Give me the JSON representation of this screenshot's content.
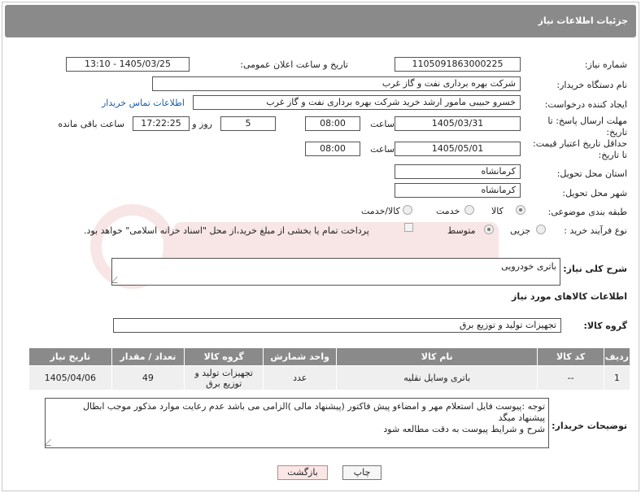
{
  "header": {
    "title": "جزئیات اطلاعات نیاز"
  },
  "form": {
    "need_number_label": "شماره نیاز:",
    "need_number": "1105091863000225",
    "announce_label": "تاریخ و ساعت اعلان عمومی:",
    "announce_value": "1405/03/25 - 13:10",
    "buyer_org_label": "نام دستگاه خریدار:",
    "buyer_org": "شرکت بهره برداری نفت و گاز غرب",
    "creator_label": "ایجاد کننده درخواست:",
    "creator": "خسرو حبیبی مامور ارشد خرید شرکت بهره برداری نفت و گاز غرب",
    "contact_link": "اطلاعات تماس خریدار",
    "deadline_label_1": "مهلت ارسال پاسخ: تا",
    "deadline_label_2": "تاریخ:",
    "deadline_date": "1405/03/31",
    "time_label": "ساعت",
    "deadline_time": "08:00",
    "days_value": "5",
    "days_label": "روز و",
    "remaining_time": "17:22:25",
    "remaining_label": "ساعت باقی مانده",
    "validity_label_1": "حداقل تاریخ اعتبار قیمت:",
    "validity_label_2": "تا تاریخ:",
    "validity_date": "1405/05/01",
    "validity_time": "08:00",
    "province_label": "استان محل تحویل:",
    "province": "کرمانشاه",
    "city_label": "شهر محل تحویل:",
    "city": "کرمانشاه",
    "category_label": "طبقه بندی موضوعی:",
    "category_options": [
      "کالا",
      "خدمت",
      "کالا/خدمت"
    ],
    "category_selected": "کالا",
    "process_label": "نوع فرآیند خرید :",
    "process_options": [
      "جزیی",
      "متوسط"
    ],
    "process_selected": "متوسط",
    "payment_note": "پرداخت تمام یا بخشی از مبلغ خرید،از محل \"اسناد خزانه اسلامی\" خواهد بود."
  },
  "description": {
    "label": "شرح کلی نیاز:",
    "value": "باتری خودرویی"
  },
  "goods": {
    "section_title": "اطلاعات کالاهای مورد نیاز",
    "group_label": "گروه کالا:",
    "group_value": "تجهیزات تولید و توزیع برق",
    "columns": [
      "ردیف",
      "کد کالا",
      "نام کالا",
      "واحد شمارش",
      "گروه کالا",
      "تعداد / مقدار",
      "تاریخ نیاز"
    ],
    "rows": [
      {
        "row": "1",
        "code": "--",
        "name": "باتری وسایل نقلیه",
        "unit": "عدد",
        "group": "تجهیزات تولید و توزیع برق",
        "qty": "49",
        "date": "1405/04/06"
      }
    ]
  },
  "buyer_notes": {
    "label": "توضیحات خریدار:",
    "line1": "توجه :پیوست فایل استعلام مهر و امضاءو پیش فاکتور (پیشنهاد مالی )الزامی می باشد عدم رعایت موارد مذکور موجب ابطال",
    "line2": "پیشنهاد میگد",
    "line3": "شرح و شرایط پیوست به دقت مطالعه شود"
  },
  "buttons": {
    "print": "چاپ",
    "back": "بازگشت"
  },
  "colors": {
    "header_bg": "#8a8a8a",
    "link": "#1a5fa8",
    "back_button": "#fbe6e6"
  }
}
